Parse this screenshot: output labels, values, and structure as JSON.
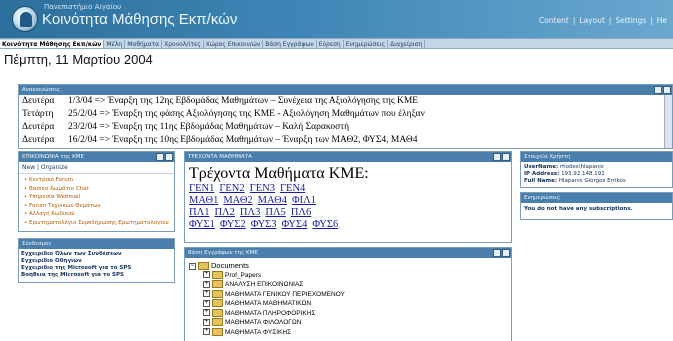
{
  "header": {
    "org": "Πανεπιστήμιο Αιγαίου",
    "title": "Κοινότητα Μάθησης Εκπ/κών",
    "links": [
      "Content",
      "Layout",
      "Settings",
      "He"
    ],
    "sep": "|"
  },
  "nav": {
    "items": [
      "Κοινότητα Μάθησης Εκπ/κών",
      "Μέλη",
      "Μαθήματα",
      "Χρονολ/ίτες",
      "Χώρος Επικοιν/ών",
      "Βάση Εγγράφων",
      "Εύρεση",
      "Ενημερώσεις",
      "Διαχείριση"
    ]
  },
  "date": "Πέμπτη, 11 Μαρτίου 2004",
  "announcements": {
    "title": "Ανακοινώσεις",
    "rows": [
      {
        "day": "Δευτέρα",
        "text": "1/3/04 => Έναρξη της 12ης Εβδομάδας Μαθημάτων – Συνέχεια της Αξιολόγησης της ΚΜΕ"
      },
      {
        "day": "Τετάρτη",
        "text": "25/2/04 => Έναρξη της φάσης Αξιολόγησης της ΚΜΕ - Αξιολόγηση Μαθημάτων που έληξαν"
      },
      {
        "day": "Δευτέρα",
        "text": "23/2/04 => Έναρξη της 11ης Εβδομάδας Μαθημάτων – Καλή Σαρακοστή"
      },
      {
        "day": "Δευτέρα",
        "text": "16/2/04 => Έναρξη της 10ης Εβδομάδας Μαθημάτων – Έναρξη των ΜΑΘ2, ΦΥΣ4, ΜΑΘ4"
      }
    ]
  },
  "communication": {
    "title": "ΕΠΙΚΟΙΝΩΝΙΑ της ΚΜΕ",
    "tabs": "New | Organize",
    "items": [
      "Κεντρικό Forum",
      "Βασικό Δωμάτιο Chat",
      "Υπηρεσία Webmail",
      "Forum Τεχνικών Θεμάτων",
      "Αλλαγή Κωδικού",
      "Ερωτηματολόγιο Συμπλήρωσης Ερωτηματολογίου"
    ]
  },
  "links": {
    "title": "Σύνδεσμος",
    "items": [
      "Εγχειρίδιο Όλων των Συνδέσεων",
      "Εγχειρίδιο Οδηγιών",
      "Εγχειρίδιο της Microsoft για το SPS",
      "Βοήθεια της Microsoft για το SPS"
    ]
  },
  "courses": {
    "title": "ΤΡΕΧΟΝΤΑ ΜΑΘΗΜΑΤΑ",
    "heading": "Τρέχοντα Μαθήματα ΚΜΕ:",
    "rows": [
      [
        "ΓΕΝ1",
        "ΓΕΝ2",
        "ΓΕΝ3",
        "ΓΕΝ4"
      ],
      [
        "ΜΑΘ1",
        "ΜΑΘ2",
        "ΜΑΘ4",
        "ΦΙΛ1"
      ],
      [
        "ΠΛ1",
        "ΠΛ2",
        "ΠΛ3",
        "ΠΛ5",
        "ΠΛ6"
      ],
      [
        "ΦΥΣ1",
        "ΦΥΣ2",
        "ΦΥΣ3",
        "ΦΥΣ4",
        "ΦΥΣ6"
      ]
    ]
  },
  "documents": {
    "title": "Βάση Εγγράφων της ΚΜΕ",
    "root": "Documents",
    "folders": [
      "Prof_Papers",
      "ΑΝΑΛΥΣΗ ΕΠΙΚΟΙΝΩΝΙΑΣ",
      "ΜΑΘΗΜΑΤΑ ΓΕΝΙΚΟΥ ΠΕΡΙΕΧΟΜΕΝΟΥ",
      "ΜΑΘΗΜΑΤΑ ΜΑΘΗΜΑΤΙΚΩΝ",
      "ΜΑΘΗΜΑΤΑ ΠΛΗΡΟΦΟΡΙΚΗΣ",
      "ΜΑΘΗΜΑΤΑ ΦΙΛΟΛΟΓΩΝ",
      "ΜΑΘΗΜΑΤΑ ΦΥΣΙΚΗΣ"
    ]
  },
  "user": {
    "title": "Στοιχεία Χρήστη",
    "lines": [
      {
        "label": "UserName:",
        "value": "rhodes\\hlapanis"
      },
      {
        "label": "IP Address:",
        "value": "193.92.148.192"
      },
      {
        "label": "Full Name:",
        "value": "Hlapanis Giorgos Errikos"
      }
    ]
  },
  "subscriptions": {
    "title": "Ενημερώσεις",
    "text": "You do not have any subscriptions."
  }
}
